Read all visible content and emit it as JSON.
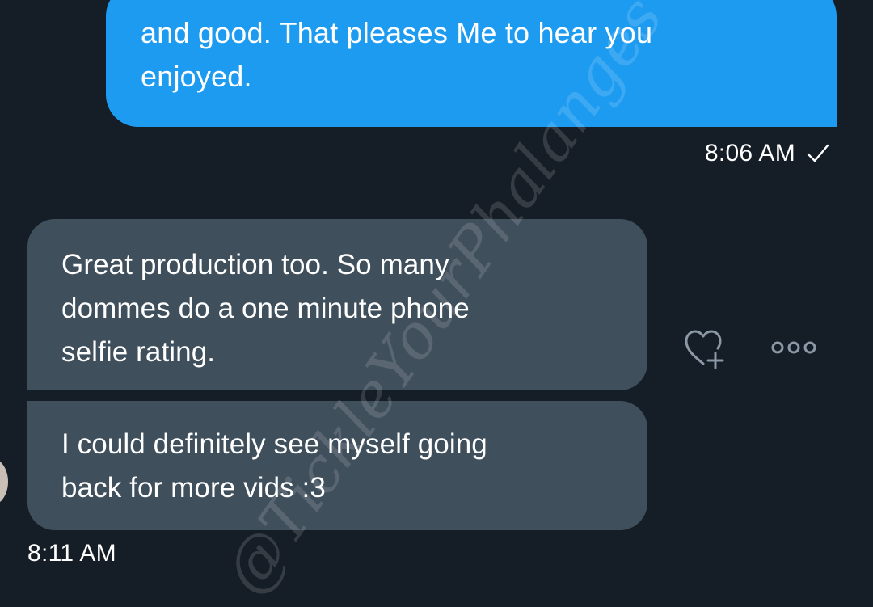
{
  "conversation": {
    "messages": [
      {
        "direction": "outgoing",
        "lines": [
          "and good. That pleases Me to hear you",
          "enjoyed."
        ],
        "time": "8:06 AM",
        "status_icon": "sent-check-icon"
      },
      {
        "direction": "incoming",
        "lines": [
          "Great production too. So many",
          "dommes do a one minute phone",
          "selfie rating."
        ]
      },
      {
        "direction": "incoming",
        "lines": [
          "I could definitely see myself going",
          "back for more vids :3"
        ],
        "time": "8:11 AM"
      }
    ],
    "actions": {
      "react_icon": "heart-plus-icon",
      "more_icon": "more-options-icon"
    }
  },
  "watermark": "@TickleYourPhalanges",
  "colors": {
    "background": "#151d26",
    "outgoing_bubble": "#1d9bf0",
    "incoming_bubble": "#3f4f5c",
    "text": "#ffffff",
    "icon": "#8b98a5"
  }
}
